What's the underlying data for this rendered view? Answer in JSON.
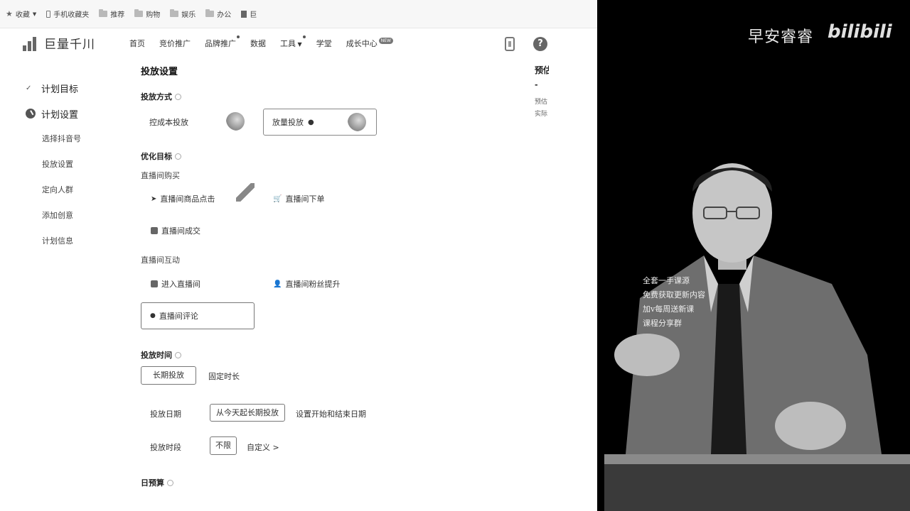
{
  "bookmarks": {
    "favorites": "收藏",
    "items": [
      "手机收藏夹",
      "推荐",
      "购物",
      "娱乐",
      "办公",
      "巨"
    ]
  },
  "app": {
    "logo": "巨量千川",
    "nav": [
      "首页",
      "竞价推广",
      "品牌推广",
      "数据",
      "工具",
      "学堂",
      "成长中心"
    ],
    "nav_badge": "NEW"
  },
  "steps": {
    "done": "计划目标",
    "current": "计划设置",
    "sub": [
      "选择抖音号",
      "投放设置",
      "定向人群",
      "添加创意",
      "计划信息"
    ]
  },
  "main": {
    "title": "投放设置",
    "mode_title": "投放方式",
    "mode_options": [
      "控成本投放",
      "放量投放"
    ],
    "goal_title": "优化目标",
    "group1": "直播间购买",
    "group1_options": [
      "直播间商品点击",
      "直播间下单",
      "直播间成交"
    ],
    "group2": "直播间互动",
    "group2_options": [
      "进入直播间",
      "直播间粉丝提升",
      "直播间评论"
    ],
    "time_title": "投放时间",
    "time_tabs": [
      "长期投放",
      "固定时长"
    ],
    "date_label": "投放日期",
    "date_value": "从今天起长期投放",
    "date_alt": "设置开始和结束日期",
    "period_label": "投放时段",
    "period_value": "不限",
    "period_alt": "自定义 >",
    "budget_title": "日预算"
  },
  "preview": {
    "title": "预估",
    "dash": "-",
    "line1": "预估",
    "line2": "实际"
  },
  "video": {
    "watermark_text": "早安睿睿",
    "watermark_logo": "bilibili",
    "overlay": [
      "全套一手课源",
      "免费获取更新内容",
      "加v每周送新课",
      "课程分享群"
    ]
  }
}
